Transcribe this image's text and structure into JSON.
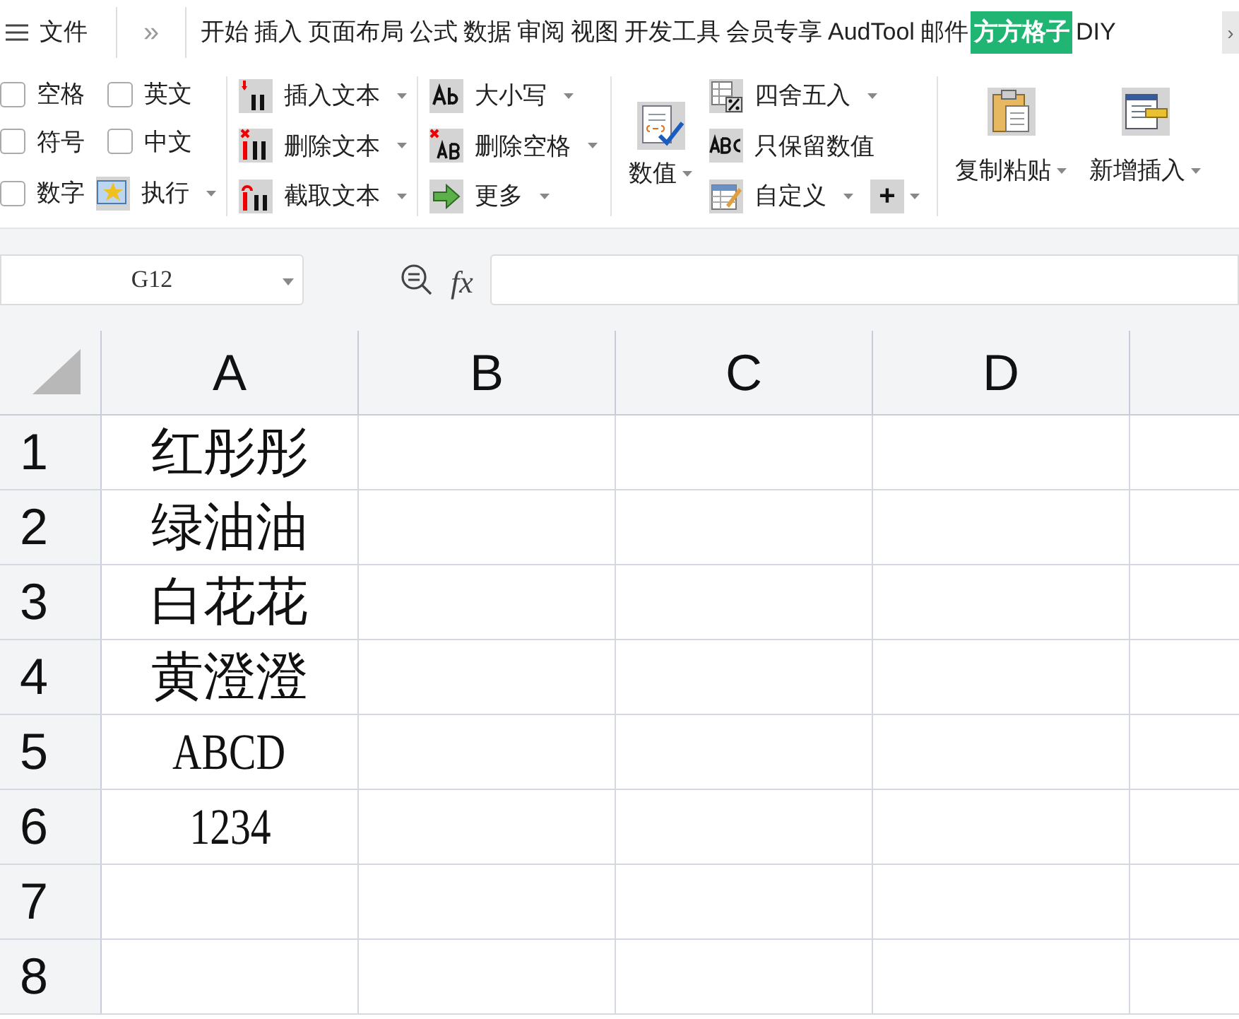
{
  "menu": {
    "label": "文件"
  },
  "more_tabs": "»",
  "tabs": [
    {
      "label": "开始",
      "selected": false
    },
    {
      "label": "插入",
      "selected": false
    },
    {
      "label": "页面布局",
      "selected": false
    },
    {
      "label": "公式",
      "selected": false
    },
    {
      "label": "数据",
      "selected": false
    },
    {
      "label": "审阅",
      "selected": false
    },
    {
      "label": "视图",
      "selected": false
    },
    {
      "label": "开发工具",
      "selected": false
    },
    {
      "label": "会员专享",
      "selected": false
    },
    {
      "label": "AudTool",
      "selected": false
    },
    {
      "label": "邮件",
      "selected": false
    },
    {
      "label": "方方格子",
      "selected": true
    },
    {
      "label": "DIY",
      "selected": false
    }
  ],
  "scroll_right": "›",
  "checkboxes": [
    {
      "label": "空格",
      "checked": false
    },
    {
      "label": "英文",
      "checked": false
    },
    {
      "label": "符号",
      "checked": false
    },
    {
      "label": "中文",
      "checked": false
    },
    {
      "label": "数字",
      "checked": false
    }
  ],
  "execute": {
    "label": "执行",
    "dropdown": true
  },
  "text_tools": [
    {
      "label": "插入文本",
      "dropdown": true
    },
    {
      "label": "删除文本",
      "dropdown": true
    },
    {
      "label": "截取文本",
      "dropdown": true
    }
  ],
  "case_tools": [
    {
      "label": "大小写",
      "dropdown": true
    },
    {
      "label": "删除空格",
      "dropdown": true
    },
    {
      "label": "更多",
      "dropdown": true
    }
  ],
  "value_button": {
    "label": "数值",
    "dropdown": true
  },
  "number_tools": [
    {
      "label": "四舍五入",
      "dropdown": true
    },
    {
      "label": "只保留数值",
      "dropdown": false
    },
    {
      "label": "自定义",
      "dropdown": true
    }
  ],
  "plus_button": {
    "label": "+",
    "dropdown": true
  },
  "large_tools": [
    {
      "label": "复制粘贴",
      "dropdown": true
    },
    {
      "label": "新增插入",
      "dropdown": true
    }
  ],
  "name_box": {
    "value": "G12"
  },
  "fx": "fx",
  "columns": [
    "A",
    "B",
    "C",
    "D"
  ],
  "rows": [
    {
      "number": "1",
      "cell": "红彤彤",
      "kind": "cjk"
    },
    {
      "number": "2",
      "cell": "绿油油",
      "kind": "cjk"
    },
    {
      "number": "3",
      "cell": "白花花",
      "kind": "cjk"
    },
    {
      "number": "4",
      "cell": "黄澄澄",
      "kind": "cjk"
    },
    {
      "number": "5",
      "cell": "ABCD",
      "kind": "latin"
    },
    {
      "number": "6",
      "cell": "1234",
      "kind": "latin"
    },
    {
      "number": "7"
    },
    {
      "number": "8"
    }
  ]
}
